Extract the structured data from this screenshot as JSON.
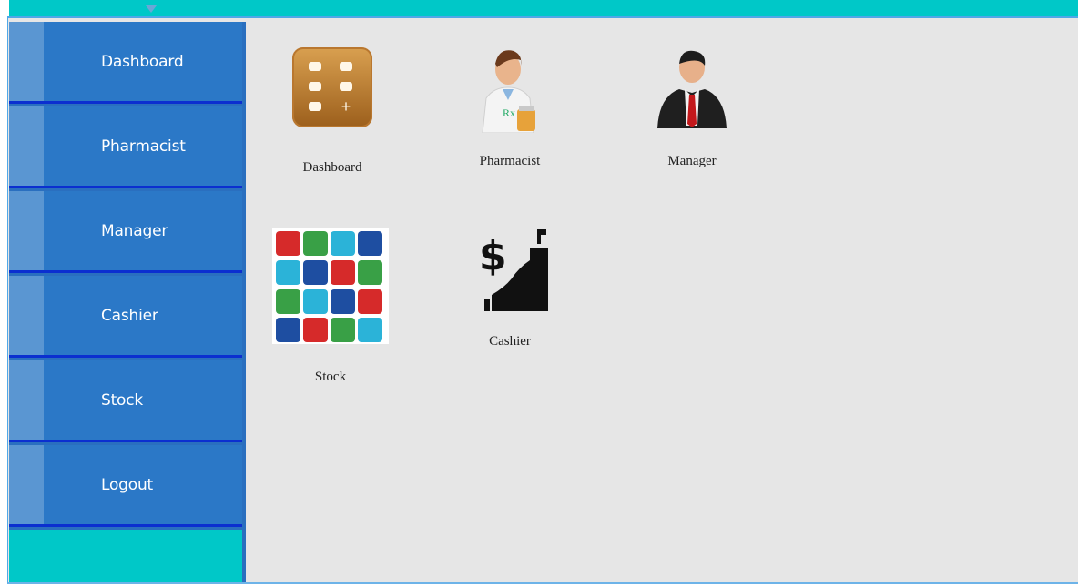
{
  "sidebar": {
    "items": [
      {
        "label": "Dashboard"
      },
      {
        "label": "Pharmacist"
      },
      {
        "label": "Manager"
      },
      {
        "label": "Cashier"
      },
      {
        "label": "Stock"
      },
      {
        "label": "Logout"
      }
    ]
  },
  "tiles": [
    {
      "caption": "Dashboard",
      "icon": "dashboard-icon"
    },
    {
      "caption": "Pharmacist",
      "icon": "pharmacist-icon"
    },
    {
      "caption": "Manager",
      "icon": "manager-icon"
    },
    {
      "caption": "Stock",
      "icon": "medicine-grid-icon"
    },
    {
      "caption": "Cashier",
      "icon": "cash-register-icon"
    }
  ],
  "colors": {
    "topbar": "#00c8c8",
    "sidebar": "#2b78c7",
    "separator": "#0b2fd0",
    "content_bg": "#e6e6e6"
  }
}
